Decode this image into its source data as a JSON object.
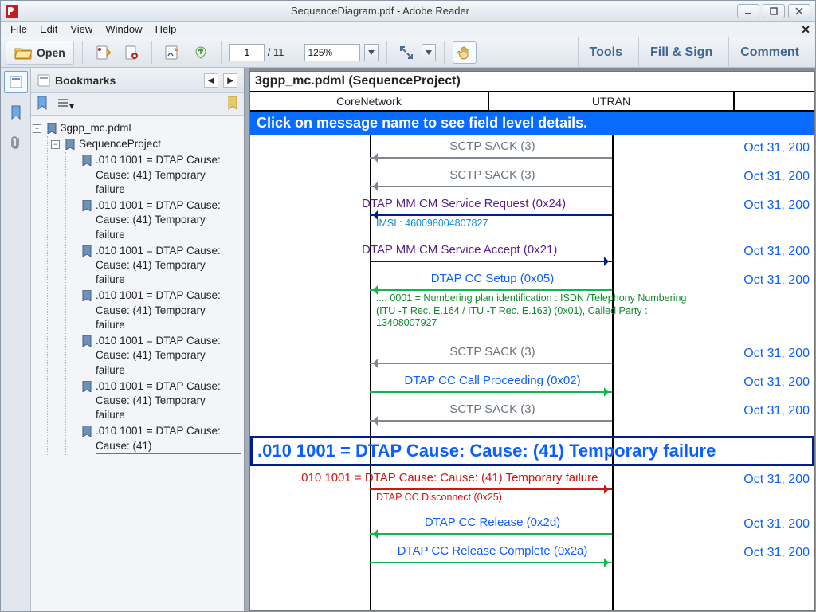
{
  "window": {
    "title": "SequenceDiagram.pdf - Adobe Reader"
  },
  "menu": {
    "file": "File",
    "edit": "Edit",
    "view": "View",
    "window": "Window",
    "help": "Help"
  },
  "toolbar": {
    "open": "Open",
    "page_current": "1",
    "page_total": "/  11",
    "zoom": "125%",
    "tools": "Tools",
    "fillsign": "Fill & Sign",
    "comment": "Comment"
  },
  "bookmarks": {
    "title": "Bookmarks",
    "root": "3gpp_mc.pdml",
    "project": "SequenceProject",
    "leaf": ".010 1001 = DTAP Cause: Cause: (41) Temporary failure",
    "leaf_last": ".010 1001 = DTAP Cause: Cause: (41)"
  },
  "doc": {
    "title": "3gpp_mc.pdml (SequenceProject)",
    "lane_core": "CoreNetwork",
    "lane_utran": "UTRAN",
    "banner": "Click on message name to see field level details.",
    "bigbanner": ".010 1001 = DTAP Cause: Cause: (41) Temporary failure",
    "timestamps": "Oct 31, 200",
    "msgs": {
      "sack": "SCTP SACK (3)",
      "svc_req": "DTAP MM CM Service Request (0x24)",
      "svc_req_sub": "IMSI : 460098004807827",
      "svc_acc": "DTAP MM CM Service Accept (0x21)",
      "cc_setup": "DTAP CC Setup (0x05)",
      "cc_setup_sub": ".... 0001 = Numbering plan identification : ISDN /Telephony Numbering (ITU -T Rec. E.164 / ITU -T Rec. E.163) (0x01), Called Party : 13408007927",
      "cc_proc": "DTAP CC Call Proceeding (0x02)",
      "cause_red": ".010 1001 = DTAP Cause: Cause: (41) Temporary failure",
      "cause_sub": "DTAP CC Disconnect (0x25)",
      "cc_rel": "DTAP CC Release (0x2d)",
      "cc_rel_comp": "DTAP CC Release Complete (0x2a)"
    }
  }
}
